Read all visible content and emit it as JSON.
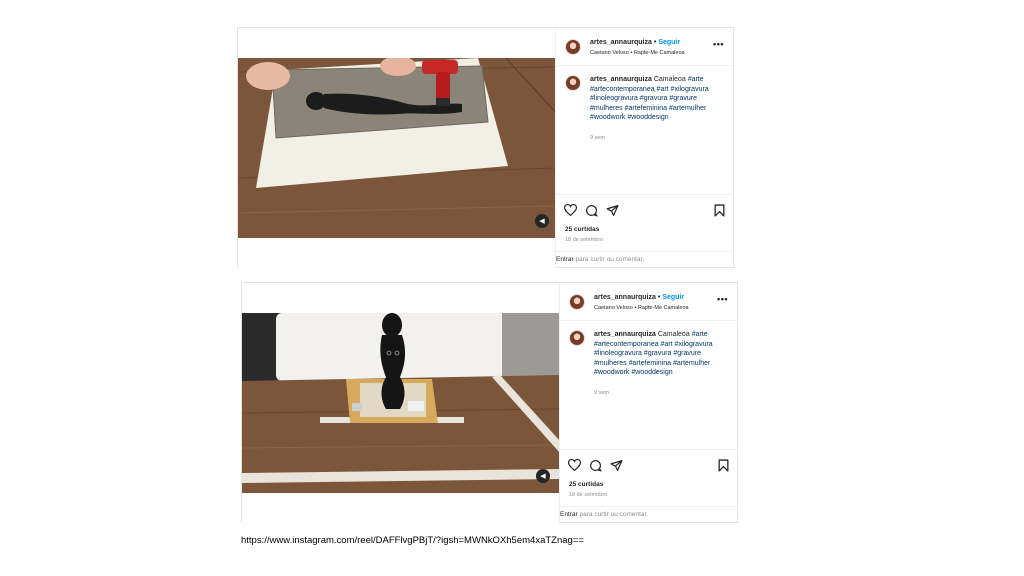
{
  "posts": [
    {
      "username": "artes_annaurquiza",
      "follow_label": "Seguir",
      "audio": "Caetano Veloso • Rapte-Me Camaleoa",
      "more_label": "•••",
      "caption_title": "Camaleoa",
      "hashtags": "#arte #artecontemporanea #art #xilogravura #linoleogravura #gravura #gravure #mulheres #artefeminina #artemulher #woodwork #wooddesign",
      "time_ago": "9 sem",
      "likes": "25 curtidas",
      "date": "18 de setembro",
      "login_link": "Entrar",
      "login_text": " para curtir ou comentar."
    },
    {
      "username": "artes_annaurquiza",
      "follow_label": "Seguir",
      "audio": "Caetano Veloso • Rapte-Me Camaleoa",
      "more_label": "•••",
      "caption_title": "Camaleoa",
      "hashtags": "#arte #artecontemporanea #art #xilogravura #linoleogravura #gravura #gravure #mulheres #artefeminina #artemulher #woodwork #wooddesign",
      "time_ago": "9 sem",
      "likes": "25 curtidas",
      "date": "18 de setembro",
      "login_link": "Entrar",
      "login_text": " para curtir ou comentar."
    }
  ],
  "url_text": "https://www.instagram.com/reel/DAFFlvgPBjT/?igsh=MWNkOXh5em4xaTZnag==",
  "icons": [
    "heart-icon",
    "comment-icon",
    "share-icon",
    "bookmark-icon",
    "sound-icon",
    "more-icon"
  ],
  "colors": {
    "follow": "#0095f6",
    "hashtag": "#00376b",
    "muted": "#8e8e8e",
    "wood": "#7b563a"
  }
}
